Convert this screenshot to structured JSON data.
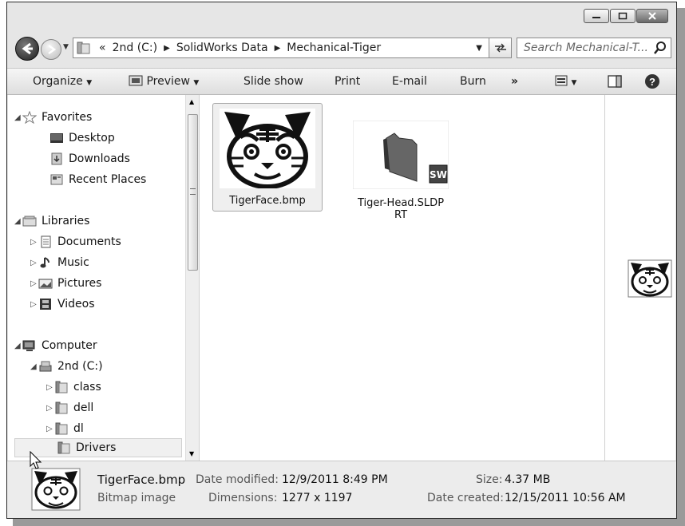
{
  "address": {
    "overflow": "«",
    "crumbs": [
      "2nd (C:)",
      "SolidWorks Data",
      "Mechanical-Tiger"
    ]
  },
  "search": {
    "placeholder": "Search Mechanical-T..."
  },
  "toolbar": {
    "organize": "Organize",
    "preview": "Preview",
    "slideshow": "Slide show",
    "print": "Print",
    "email": "E-mail",
    "burn": "Burn",
    "more": "»"
  },
  "nav": {
    "favorites": "Favorites",
    "desktop": "Desktop",
    "downloads": "Downloads",
    "recent": "Recent Places",
    "libraries": "Libraries",
    "documents": "Documents",
    "music": "Music",
    "pictures": "Pictures",
    "videos": "Videos",
    "computer": "Computer",
    "drive": "2nd (C:)",
    "class": "class",
    "dell": "dell",
    "dl": "dl",
    "drivers": "Drivers"
  },
  "files": [
    {
      "name": "TigerFace.bmp",
      "icon": "tiger-face-image"
    },
    {
      "name_line1": "Tiger-Head.SLDP",
      "name_line2": "RT",
      "icon": "solidworks-part"
    }
  ],
  "details": {
    "filename": "TigerFace.bmp",
    "filetype": "Bitmap image",
    "modified_label": "Date modified:",
    "modified_value": "12/9/2011 8:49 PM",
    "dimensions_label": "Dimensions:",
    "dimensions_value": "1277 x 1197",
    "size_label": "Size:",
    "size_value": "4.37 MB",
    "created_label": "Date created:",
    "created_value": "12/15/2011 10:56 AM"
  }
}
